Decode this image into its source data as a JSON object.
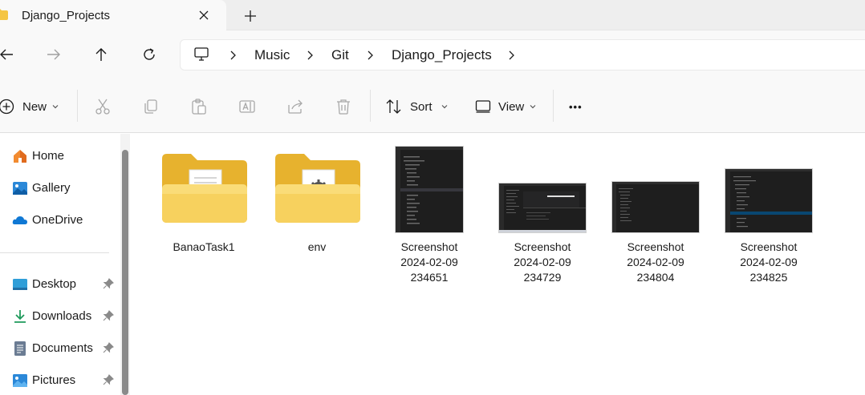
{
  "tab": {
    "title": "Django_Projects",
    "icons": {
      "folder": "folder-icon",
      "close": "close-icon",
      "new": "plus-icon"
    }
  },
  "nav": {
    "buttons": [
      "back-arrow-icon",
      "forward-arrow-icon",
      "up-arrow-icon",
      "refresh-icon"
    ],
    "breadcrumbs": [
      "Music",
      "Git",
      "Django_Projects"
    ]
  },
  "commands": {
    "new_label": "New",
    "sort_label": "Sort",
    "view_label": "View",
    "more_glyph": "•••"
  },
  "sidebar": {
    "items": [
      {
        "label": "Home",
        "icon": "home-icon",
        "pinned": false
      },
      {
        "label": "Gallery",
        "icon": "gallery-icon",
        "pinned": false
      },
      {
        "label": "OneDrive",
        "icon": "onedrive-icon",
        "pinned": false
      },
      {
        "label": "Desktop",
        "icon": "desktop-icon",
        "pinned": true
      },
      {
        "label": "Downloads",
        "icon": "downloads-icon",
        "pinned": true
      },
      {
        "label": "Documents",
        "icon": "documents-icon",
        "pinned": true
      },
      {
        "label": "Pictures",
        "icon": "pictures-icon",
        "pinned": true
      }
    ]
  },
  "files": [
    {
      "type": "folder",
      "line1": "BanaoTask1",
      "line2": "",
      "line3": ""
    },
    {
      "type": "folder",
      "line1": "env",
      "line2": "",
      "line3": ""
    },
    {
      "type": "image",
      "line1": "Screenshot",
      "line2": "2024-02-09",
      "line3": "234651"
    },
    {
      "type": "image",
      "line1": "Screenshot",
      "line2": "2024-02-09",
      "line3": "234729"
    },
    {
      "type": "image",
      "line1": "Screenshot",
      "line2": "2024-02-09",
      "line3": "234804"
    },
    {
      "type": "image",
      "line1": "Screenshot",
      "line2": "2024-02-09",
      "line3": "234825"
    }
  ],
  "colors": {
    "folder": "#f5c542",
    "folder_dark": "#e7b22e",
    "accent": "#0067c0",
    "thumb_bg": "#1e1e1e"
  }
}
